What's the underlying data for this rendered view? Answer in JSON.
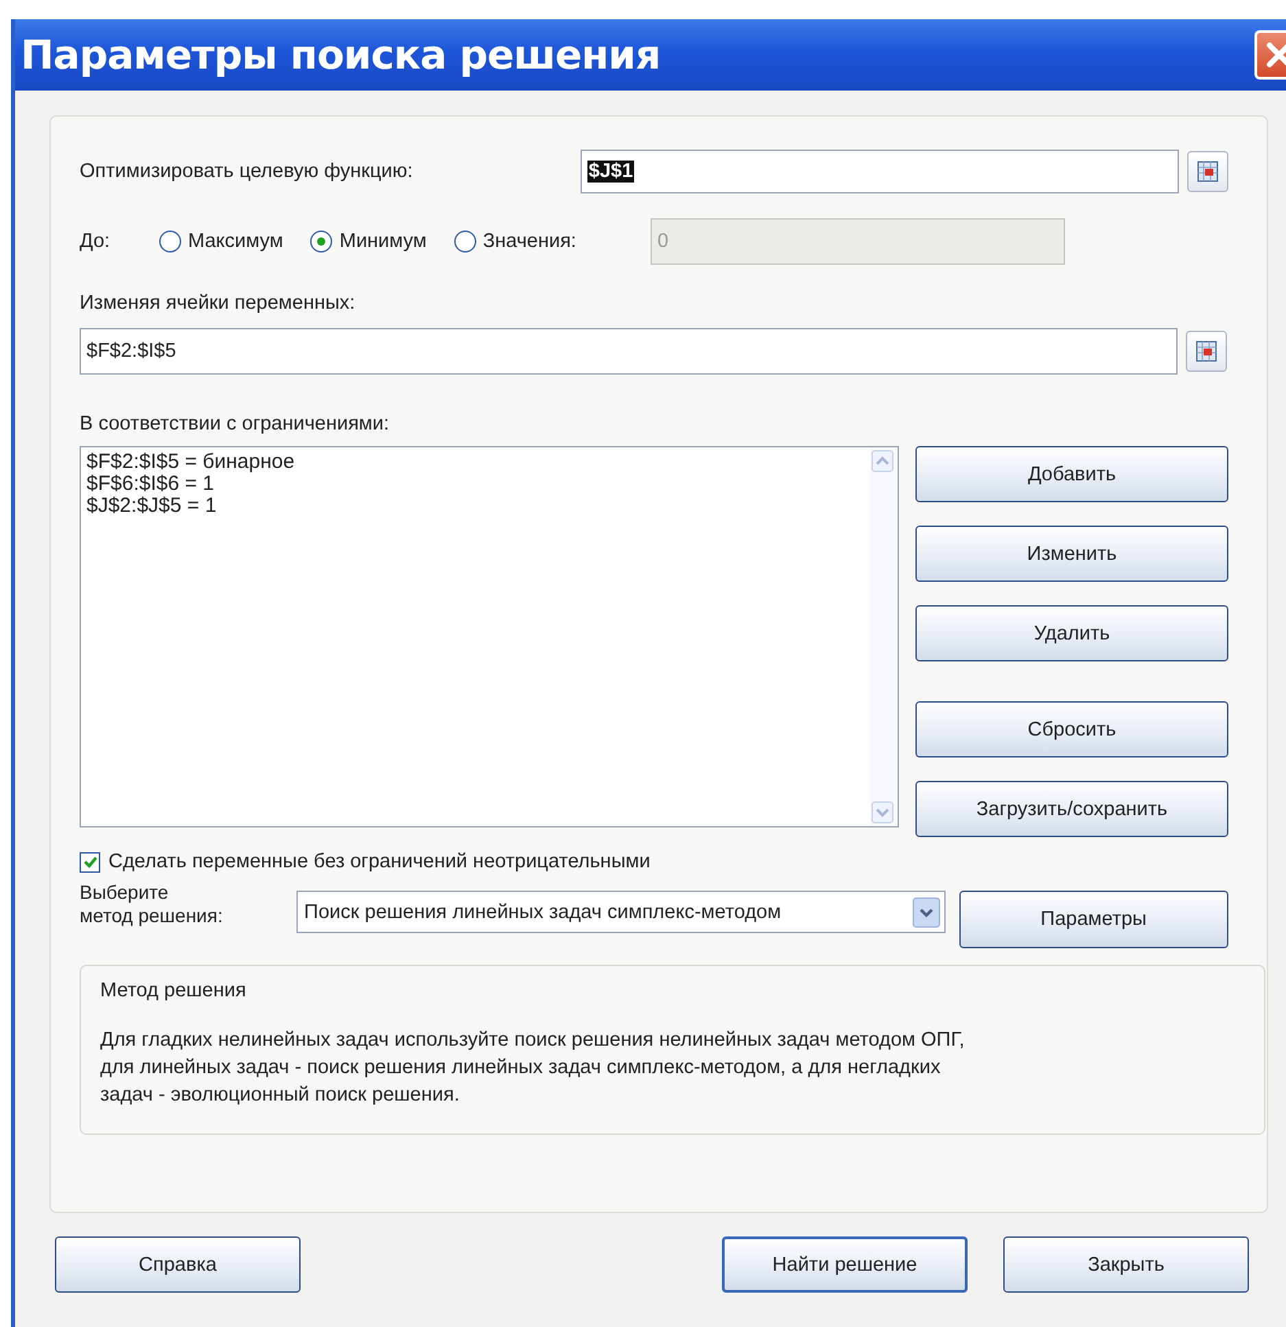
{
  "window": {
    "title": "Параметры поиска решения"
  },
  "objective": {
    "label": "Оптимизировать целевую функцию:",
    "value": "$J$1"
  },
  "target": {
    "label": "До:",
    "options": [
      {
        "label": "Максимум",
        "selected": false
      },
      {
        "label": "Минимум",
        "selected": true
      },
      {
        "label": "Значения:",
        "selected": false
      }
    ],
    "value_field": {
      "value": "0",
      "disabled": true
    }
  },
  "variables": {
    "label": "Изменяя ячейки переменных:",
    "value": "$F$2:$I$5"
  },
  "constraints": {
    "label": "В соответствии с ограничениями:",
    "items": [
      "$F$2:$I$5 = бинарное",
      "$F$6:$I$6 = 1",
      "$J$2:$J$5 = 1"
    ]
  },
  "constraint_buttons": [
    {
      "label": "Добавить"
    },
    {
      "label": "Изменить"
    },
    {
      "label": "Удалить"
    },
    {
      "label": "Сбросить"
    },
    {
      "label": "Загрузить/сохранить"
    }
  ],
  "nonnegative": {
    "label": "Сделать переменные без ограничений неотрицательными",
    "checked": true
  },
  "method": {
    "label_lines": [
      "Выберите",
      "метод решения:"
    ],
    "value": "Поиск решения линейных задач симплекс-методом",
    "options_button": "Параметры"
  },
  "method_group": {
    "title": "Метод решения",
    "description_lines": [
      "Для гладких нелинейных задач используйте поиск решения нелинейных задач методом ОПГ,",
      "для линейных задач - поиск решения линейных задач симплекс-методом, а для негладких",
      "задач - эволюционный поиск решения."
    ]
  },
  "buttons": [
    {
      "label": "Справка",
      "default": false
    },
    {
      "label": "Найти решение",
      "default": true
    },
    {
      "label": "Закрыть",
      "default": false
    }
  ]
}
